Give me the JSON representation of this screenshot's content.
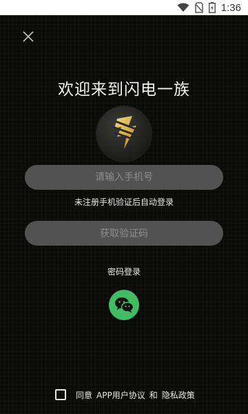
{
  "status_bar": {
    "time": "1:36",
    "icons": [
      "wifi-icon",
      "sim-no-signal-icon",
      "battery-charging-icon"
    ]
  },
  "login": {
    "close_icon": "close-icon",
    "title": "欢迎来到闪电一族",
    "logo_icon": "lightning-bolt-logo",
    "phone_placeholder": "请输入手机号",
    "hint": "未注册手机验证后自动登录",
    "get_code_label": "获取验证码",
    "password_login_label": "密码登录",
    "wechat_icon": "wechat-icon",
    "wechat_color": "#3fbd63",
    "agreement": {
      "prefix": "同意",
      "user_agreement": "APP用户协议",
      "conjunction": "和",
      "privacy_policy": "隐私政策",
      "checked": false
    }
  }
}
